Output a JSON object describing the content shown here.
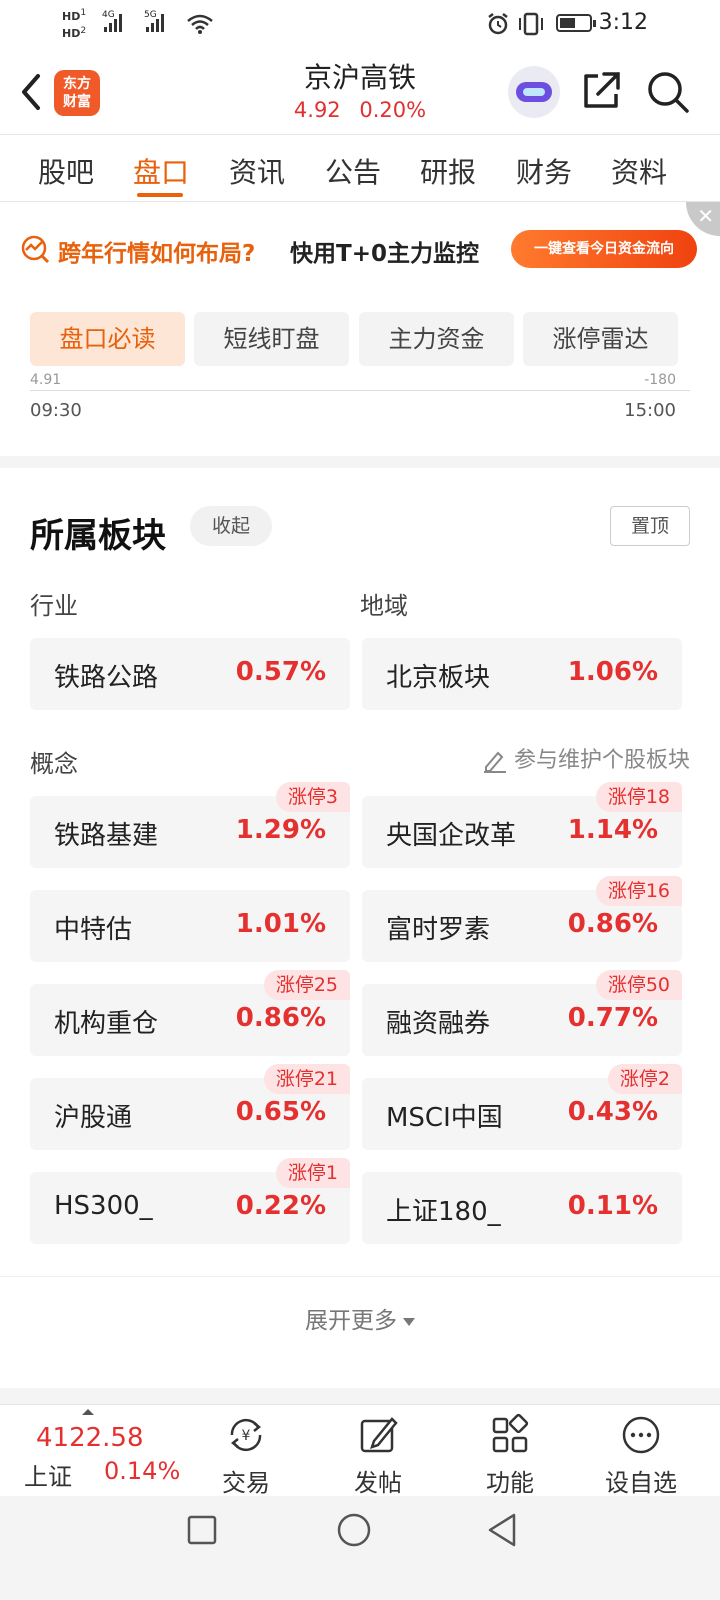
{
  "status": {
    "sim1": "HD",
    "sim2": "HD",
    "net1": "4G",
    "net2": "5G",
    "time": "3:12"
  },
  "header": {
    "logo_line1": "东方",
    "logo_line2": "财富",
    "title": "京沪高铁",
    "price": "4.92",
    "change": "0.20%"
  },
  "tabs": [
    "股吧",
    "盘口",
    "资讯",
    "公告",
    "研报",
    "财务",
    "资料"
  ],
  "promo": {
    "text_orange": "跨年行情如何布局?",
    "text_dark": "快用T+0主力监控",
    "button": "一键查看今日资金流向",
    "close": "✕"
  },
  "pills": [
    "盘口必读",
    "短线盯盘",
    "主力资金",
    "涨停雷达"
  ],
  "mini_chart": {
    "start_time": "09:30",
    "end_time": "15:00",
    "left_cut": "4.91",
    "right_cut": "-180"
  },
  "sector": {
    "title": "所属板块",
    "collapse": "收起",
    "pin": "置顶",
    "industry_label": "行业",
    "region_label": "地域",
    "concept_label": "概念",
    "contribute": "参与维护个股板块",
    "industry": {
      "name": "铁路公路",
      "pct": "0.57%"
    },
    "region": {
      "name": "北京板块",
      "pct": "1.06%"
    },
    "concepts": [
      {
        "name": "铁路基建",
        "pct": "1.29%",
        "limit": "涨停3"
      },
      {
        "name": "央国企改革",
        "pct": "1.14%",
        "limit": "涨停18"
      },
      {
        "name": "中特估",
        "pct": "1.01%",
        "limit": ""
      },
      {
        "name": "富时罗素",
        "pct": "0.86%",
        "limit": "涨停16"
      },
      {
        "name": "机构重仓",
        "pct": "0.86%",
        "limit": "涨停25"
      },
      {
        "name": "融资融券",
        "pct": "0.77%",
        "limit": "涨停50"
      },
      {
        "name": "沪股通",
        "pct": "0.65%",
        "limit": "涨停21"
      },
      {
        "name": "MSCI中国",
        "pct": "0.43%",
        "limit": "涨停2"
      },
      {
        "name": "HS300_",
        "pct": "0.22%",
        "limit": "涨停1"
      },
      {
        "name": "上证180_",
        "pct": "0.11%",
        "limit": ""
      }
    ],
    "more": "展开更多"
  },
  "bottom": {
    "index_value": "4122.58",
    "index_name": "上证",
    "index_pct": "0.14%",
    "items": [
      "交易",
      "发帖",
      "功能",
      "设自选"
    ]
  },
  "colors": {
    "accent": "#e8610c",
    "up": "#e53030"
  }
}
